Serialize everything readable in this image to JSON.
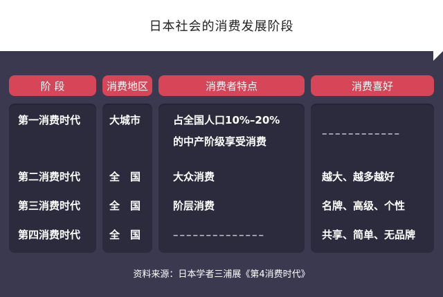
{
  "title": "日本社会的消费发展阶段",
  "headers": [
    "阶 段",
    "消费地区",
    "消费者特点",
    "消费喜好"
  ],
  "rows": [
    {
      "stage": "第一消费时代",
      "region": "大城市",
      "traits_line1": "占全国人口10%–20%",
      "traits_line2": "的中产阶级享受消费",
      "preference": "––––––––––––"
    },
    {
      "stage": "第二消费时代",
      "region": "全　国",
      "traits": "大众消费",
      "preference": "越大、越多越好"
    },
    {
      "stage": "第三消费时代",
      "region": "全　国",
      "traits": "阶层消费",
      "preference": "名牌、高级、个性"
    },
    {
      "stage": "第四消费时代",
      "region": "全　国",
      "traits": "––––––––––––––",
      "preference": "共享、简单、无品牌"
    }
  ],
  "footer": "资料来源：日本学者三浦展《第4消费时代》",
  "colors": {
    "background": "#3b3950",
    "header": "#d64558",
    "cell_bg": "#2c2a3d",
    "title_bg": "#ffffff"
  }
}
